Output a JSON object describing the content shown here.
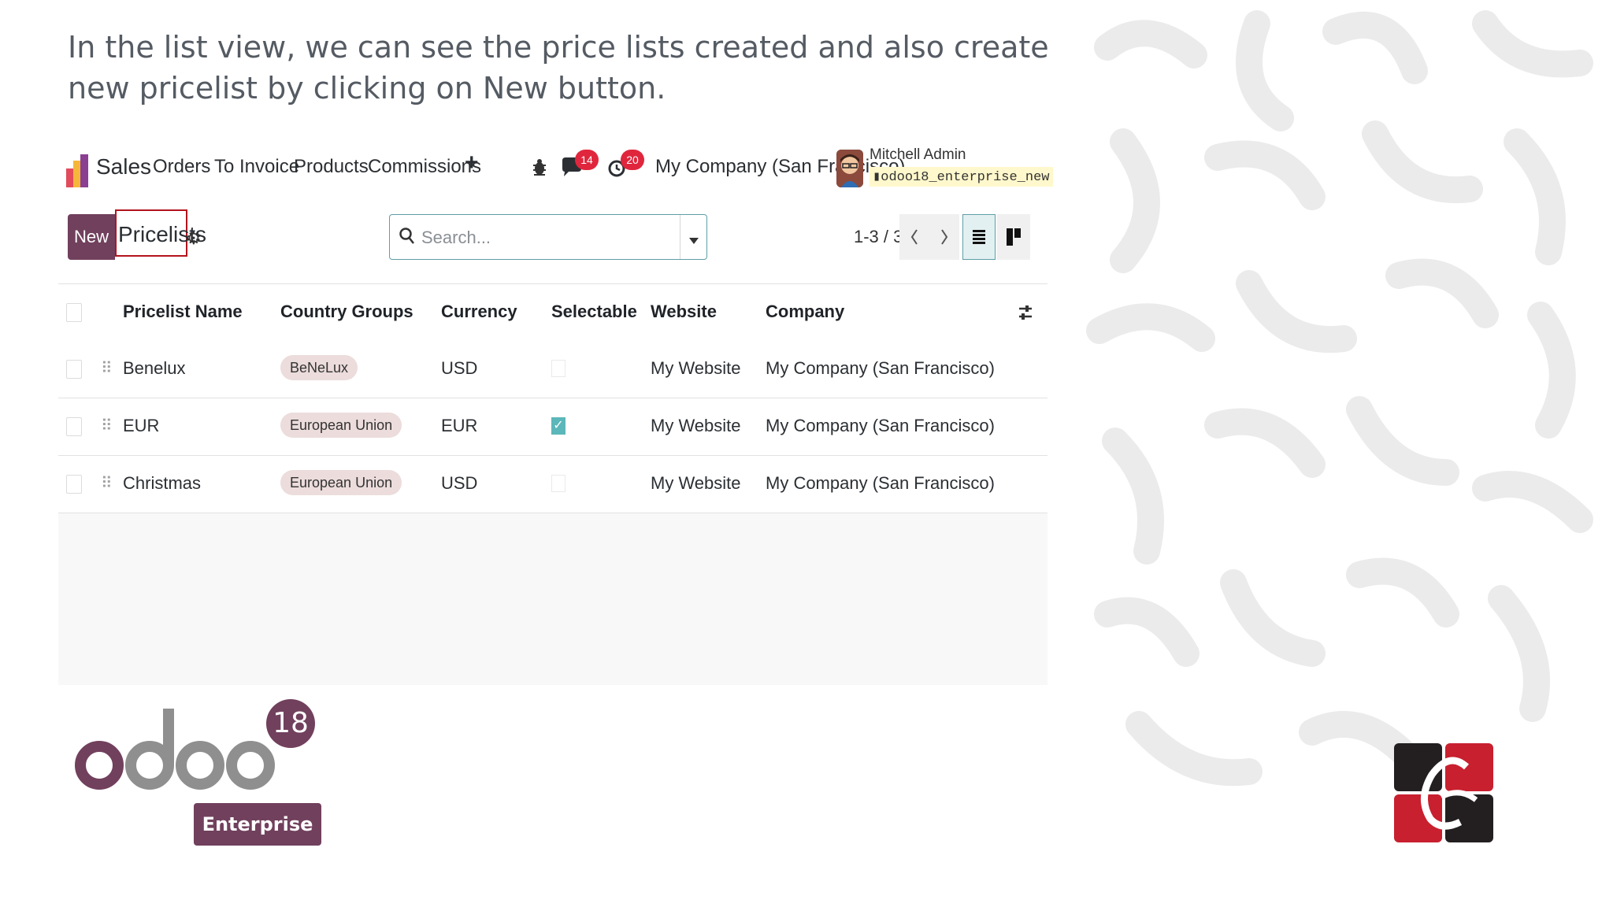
{
  "caption": "In the list view, we can see the price lists created and also create new pricelist by clicking on New button.",
  "navbar": {
    "app_name": "Sales",
    "menu": [
      "Orders",
      "To Invoice",
      "Products",
      "Commissions"
    ],
    "add_icon": "plus-icon",
    "messages_count": "14",
    "activities_count": "20",
    "company": "My Company (San Francisco)",
    "user_name": "Mitchell Admin",
    "database": "odoo18_enterprise_new"
  },
  "control_panel": {
    "new_label": "New",
    "breadcrumb": "Pricelists",
    "search_placeholder": "Search...",
    "pager": "1-3 / 3"
  },
  "table": {
    "columns": [
      "Pricelist Name",
      "Country Groups",
      "Currency",
      "Selectable",
      "Website",
      "Company"
    ],
    "rows": [
      {
        "name": "Benelux",
        "country_group": "BeNeLux",
        "currency": "USD",
        "selectable": false,
        "website": "My Website",
        "company": "My Company (San Francisco)"
      },
      {
        "name": "EUR",
        "country_group": "European Union",
        "currency": "EUR",
        "selectable": true,
        "website": "My Website",
        "company": "My Company (San Francisco)"
      },
      {
        "name": "Christmas",
        "country_group": "European Union",
        "currency": "USD",
        "selectable": false,
        "website": "My Website",
        "company": "My Company (San Francisco)"
      }
    ]
  },
  "branding": {
    "logo_text": "odoo",
    "version": "18",
    "edition": "Enterprise"
  },
  "colors": {
    "brand": "#71405d",
    "badge": "#e0263d",
    "highlight_border": "#b3131d",
    "checkbox_on": "#5bb7b9"
  }
}
